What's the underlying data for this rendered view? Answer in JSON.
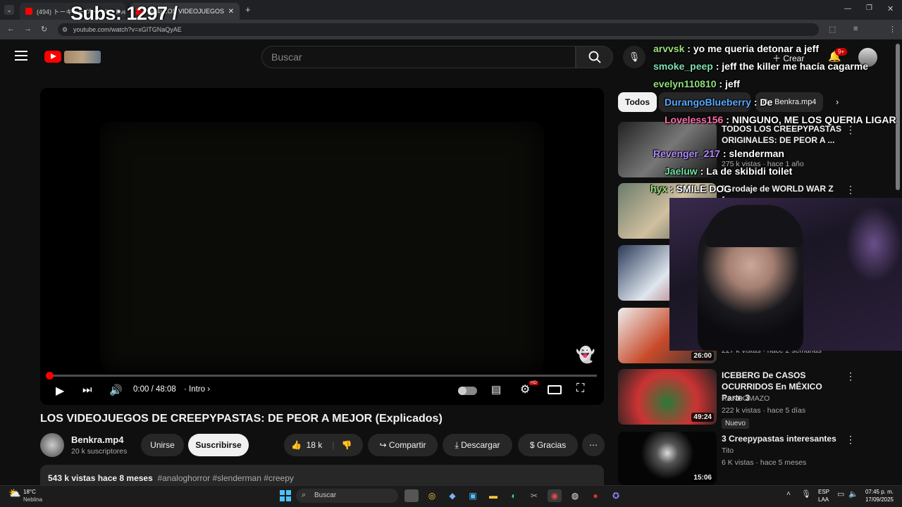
{
  "browser": {
    "tabs": [
      {
        "label": "(494) トーキョーグーール - Eve"
      },
      {
        "label": "(494) LOS VIDEOJUEGOS DE CREEPYPASTAS"
      }
    ],
    "url": "youtube.com/watch?v=xGITGNaQyAE"
  },
  "overlay": {
    "subs": "Subs: 1297 /"
  },
  "header": {
    "search_placeholder": "Buscar",
    "create_label": "Crear",
    "notifications_badge": "9+"
  },
  "player": {
    "time": "0:00 / 48:08",
    "chapter": "Intro",
    "settings_badge": "HD"
  },
  "video": {
    "title": "LOS VIDEOJUEGOS DE CREEPYPASTAS: DE PEOR A MEJOR (Explicados)",
    "channel": "Benkra.mp4",
    "subscribers": "20 k suscriptores",
    "join_label": "Unirse",
    "subscribe_label": "Suscribirse",
    "likes": "18 k",
    "share_label": "Compartir",
    "download_label": "Descargar",
    "thanks_label": "Gracias",
    "description": "543 k vistas  hace 8 meses",
    "hashtags": "#analoghorror #slenderman #creepy"
  },
  "chips": [
    {
      "label": "Todos"
    },
    {
      "label": "De Benkra.mp4"
    }
  ],
  "sidebar": {
    "videos": [
      {
        "title": "TODOS LOS CREEPYPASTAS ORIGINALES: DE PEOR A ...",
        "meta": "275 k vistas · hace 1 año",
        "duration": ""
      },
      {
        "title": "El rodaje de WORLD WAR Z fue",
        "meta": "",
        "duration": ""
      },
      {
        "title": "",
        "meta": "",
        "duration": ""
      },
      {
        "title": "",
        "meta": "227 k vistas · hace 2 semanas",
        "duration": "26:00"
      },
      {
        "title": "ICEBERG De CASOS OCURRIDOS En MÉXICO Parte 3",
        "channel": "RANDOMAZO",
        "meta": "222 k vistas · hace 5 días",
        "badge": "Nuevo",
        "duration": "49:24"
      },
      {
        "title": "3 Creepypastas interesantes",
        "channel": "Tito",
        "meta": "6 K vistas · hace 5 meses",
        "duration": "15:06"
      }
    ]
  },
  "chat": [
    {
      "user": "arvvsk",
      "msg": ": yo me queria detonar a jeff",
      "color": "#9be37d"
    },
    {
      "user": "smoke_peep",
      "msg": ": jeff the killer me hacía cagarme",
      "color": "#7fe0b0"
    },
    {
      "user": "evelyn110810",
      "msg": ": jeff",
      "color": "#8fe07a"
    },
    {
      "user": "DurangoBlueberry",
      "msg": ": De",
      "color": "#5aa9ff"
    },
    {
      "user": "Loveless156",
      "msg": ": NINGUNO, ME LOS QUERIA LIGAR",
      "color": "#ff6fa8"
    },
    {
      "user": "Revenger_217",
      "msg": ": slenderman",
      "color": "#b28cff"
    },
    {
      "user": "Jaeluw",
      "msg": ": La de skibidi toilet",
      "color": "#6fe3a0"
    },
    {
      "user": "hyx",
      "msg": ": SMILE DOG",
      "color": "#9be37d"
    }
  ],
  "taskbar": {
    "weather_temp": "18°C",
    "weather_desc": "Neblina",
    "search": "Buscar",
    "lang1": "ESP",
    "lang2": "LAA",
    "time": "07:45 p. m.",
    "date": "17/09/2025"
  }
}
